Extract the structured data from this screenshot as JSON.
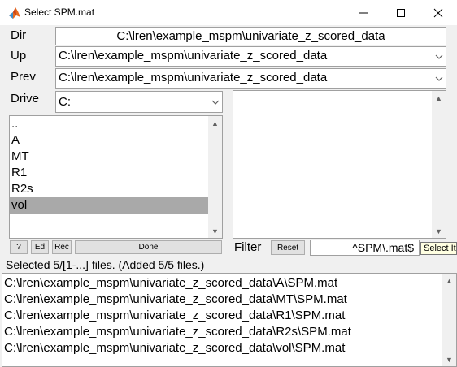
{
  "window": {
    "title": "Select SPM.mat",
    "minimize_label": "minimize",
    "maximize_label": "maximize",
    "close_label": "close"
  },
  "labels": {
    "dir": "Dir",
    "up": "Up",
    "prev": "Prev",
    "drive": "Drive",
    "filter": "Filter"
  },
  "dir_value": "C:\\lren\\example_mspm\\univariate_z_scored_data",
  "up_value": "C:\\lren\\example_mspm\\univariate_z_scored_data",
  "prev_value": "C:\\lren\\example_mspm\\univariate_z_scored_data",
  "drive_value": "C:",
  "dir_list": [
    "..",
    "A",
    "MT",
    "R1",
    "R2s",
    "vol"
  ],
  "dir_list_selected": "vol",
  "buttons": {
    "help": "?",
    "ed": "Ed",
    "rec": "Rec",
    "done": "Done",
    "reset": "Reset"
  },
  "filter_value": "^SPM\\.mat$",
  "tooltip": "Select It",
  "status": "Selected 5/[1-...] files. (Added 5/5 files.)",
  "selected_files": [
    "C:\\lren\\example_mspm\\univariate_z_scored_data\\A\\SPM.mat",
    "C:\\lren\\example_mspm\\univariate_z_scored_data\\MT\\SPM.mat",
    "C:\\lren\\example_mspm\\univariate_z_scored_data\\R1\\SPM.mat",
    "C:\\lren\\example_mspm\\univariate_z_scored_data\\R2s\\SPM.mat",
    "C:\\lren\\example_mspm\\univariate_z_scored_data\\vol\\SPM.mat"
  ],
  "colors": {
    "selection": "#a9a9a9",
    "background": "#f0f0f0"
  }
}
